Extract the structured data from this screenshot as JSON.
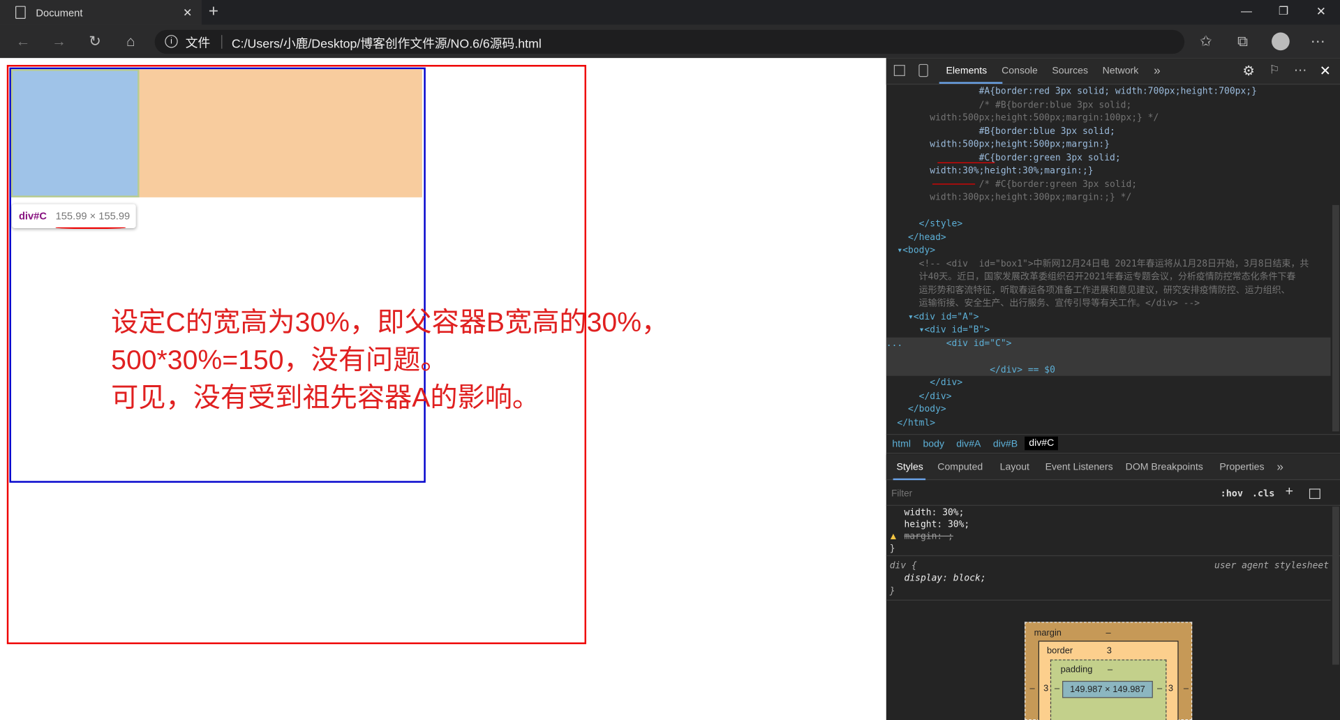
{
  "browser": {
    "tab_title": "Document",
    "new_tab": "+",
    "addr_label": "文件",
    "url": "C:/Users/小鹿/Desktop/博客创作文件源/NO.6/6源码.html",
    "win_min": "—",
    "win_restore": "❐",
    "win_close": "✕",
    "tab_close": "✕"
  },
  "page": {
    "tooltip_el": "div#C",
    "tooltip_size": "155.99 × 155.99",
    "note_line1": "设定C的宽高为30%，即父容器B宽高的30%，",
    "note_line2": "500*30%=150，没有问题。",
    "note_line3": "可见，没有受到祖先容器A的影响。"
  },
  "devtools": {
    "tabs": [
      "Elements",
      "Console",
      "Sources",
      "Network",
      "»"
    ],
    "code": [
      "                 #A{border:red 3px solid; width:700px;height:700px;}",
      "                 /* #B{border:blue 3px solid;",
      "        width:500px;height:500px;margin:100px;} */",
      "                 #B{border:blue 3px solid;",
      "        width:500px;height:500px;margin:}",
      "                 #C{border:green 3px solid;",
      "        width:30%;height:30%;margin:;}",
      "                 /* #C{border:green 3px solid;",
      "        width:300px;height:300px;margin:;} */",
      "",
      "      </style>",
      "    </head>",
      "  ▾<body>",
      "      <!-- <div  id=\"box1\">中新网12月24日电 2021年春运将从1月28日开始，3月8日结束，共",
      "      计40天。近日，国家发展改革委组织召开2021年春运专题会议，分析疫情防控常态化条件下春",
      "      运形势和客流特征，听取春运各项准备工作进展和意见建议，研究安排疫情防控、运力组织、",
      "      运输衔接、安全生产、出行服务、宣传引导等有关工作。</div> -->",
      "    ▾<div id=\"A\">",
      "      ▾<div id=\"B\">",
      "...        <div id=\"C\">",
      "",
      "                   </div> == $0",
      "        </div>",
      "      </div>",
      "    </body>",
      "  </html>"
    ],
    "crumbs": [
      "html",
      "body",
      "div#A",
      "div#B",
      "div#C"
    ],
    "style_tabs": [
      "Styles",
      "Computed",
      "Layout",
      "Event Listeners",
      "DOM Breakpoints",
      "Properties",
      "»"
    ],
    "filter_placeholder": "Filter",
    "hov": ":hov",
    "cls": ".cls",
    "plus": "+",
    "rule_lines": [
      "width: 30%;",
      "height: 30%;",
      "margin: ;",
      "}"
    ],
    "ua_selector": "div {",
    "ua_label": "user agent stylesheet",
    "ua_prop": "display: block;",
    "ua_close": "}",
    "box": {
      "margin_label": "margin",
      "margin_val": "–",
      "border_label": "border",
      "border_val": "3",
      "padding_label": "padding",
      "padding_val": "–",
      "content": "149.987 × 149.987",
      "left_margin": "–",
      "left_border": "3",
      "left_padding": "–",
      "right_padding": "–",
      "right_border": "3",
      "right_margin": "–"
    }
  }
}
